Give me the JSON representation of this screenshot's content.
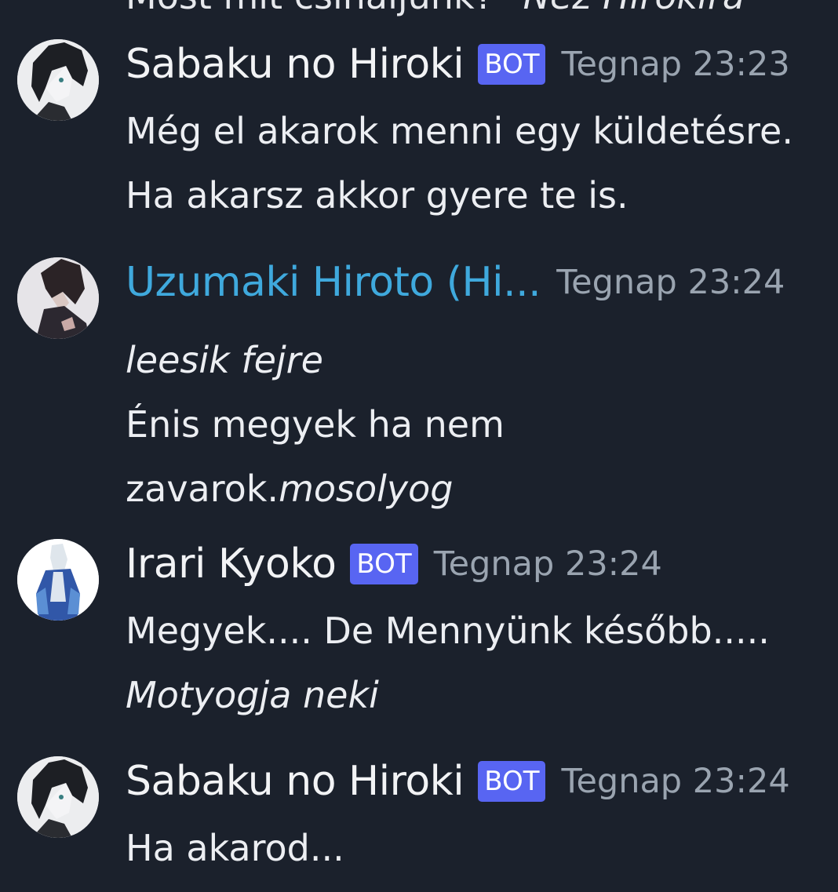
{
  "cutoff_line": {
    "text": "Most mit csinaljunk? ",
    "italic": "*Néz Hirokira"
  },
  "messages": [
    {
      "author": "Sabaku no Hiroki",
      "badge": "BOT",
      "timestamp": "Tegnap 23:23",
      "lines": [
        "Még el akarok menni egy küldetésre.",
        "Ha akarsz akkor gyere te is."
      ]
    },
    {
      "author": "Uzumaki Hiroto (Hi...",
      "author_color": "#3fa9dd",
      "timestamp": "Tegnap 23:24",
      "lines": [
        "leesik fejre",
        "Énis megyek ha nem",
        "zavarok.",
        "mosolyog"
      ]
    },
    {
      "author": "Irari Kyoko",
      "badge": "BOT",
      "timestamp": "Tegnap 23:24",
      "lines": [
        "Megyek.... De Mennyünk később.....",
        "Motyogja neki"
      ]
    },
    {
      "author": "Sabaku no Hiroki",
      "badge": "BOT",
      "timestamp": "Tegnap 23:24",
      "lines": [
        "Ha akarod..."
      ]
    }
  ]
}
